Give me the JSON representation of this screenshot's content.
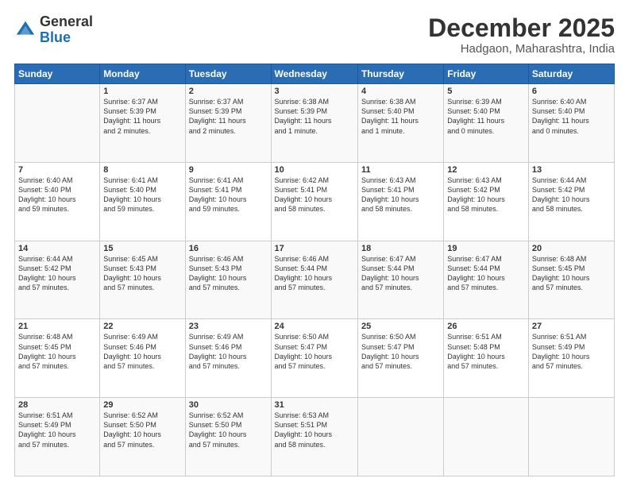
{
  "logo": {
    "general": "General",
    "blue": "Blue"
  },
  "header": {
    "month": "December 2025",
    "location": "Hadgaon, Maharashtra, India"
  },
  "days_of_week": [
    "Sunday",
    "Monday",
    "Tuesday",
    "Wednesday",
    "Thursday",
    "Friday",
    "Saturday"
  ],
  "weeks": [
    [
      {
        "day": "",
        "info": ""
      },
      {
        "day": "1",
        "info": "Sunrise: 6:37 AM\nSunset: 5:39 PM\nDaylight: 11 hours\nand 2 minutes."
      },
      {
        "day": "2",
        "info": "Sunrise: 6:37 AM\nSunset: 5:39 PM\nDaylight: 11 hours\nand 2 minutes."
      },
      {
        "day": "3",
        "info": "Sunrise: 6:38 AM\nSunset: 5:39 PM\nDaylight: 11 hours\nand 1 minute."
      },
      {
        "day": "4",
        "info": "Sunrise: 6:38 AM\nSunset: 5:40 PM\nDaylight: 11 hours\nand 1 minute."
      },
      {
        "day": "5",
        "info": "Sunrise: 6:39 AM\nSunset: 5:40 PM\nDaylight: 11 hours\nand 0 minutes."
      },
      {
        "day": "6",
        "info": "Sunrise: 6:40 AM\nSunset: 5:40 PM\nDaylight: 11 hours\nand 0 minutes."
      }
    ],
    [
      {
        "day": "7",
        "info": "Sunrise: 6:40 AM\nSunset: 5:40 PM\nDaylight: 10 hours\nand 59 minutes."
      },
      {
        "day": "8",
        "info": "Sunrise: 6:41 AM\nSunset: 5:40 PM\nDaylight: 10 hours\nand 59 minutes."
      },
      {
        "day": "9",
        "info": "Sunrise: 6:41 AM\nSunset: 5:41 PM\nDaylight: 10 hours\nand 59 minutes."
      },
      {
        "day": "10",
        "info": "Sunrise: 6:42 AM\nSunset: 5:41 PM\nDaylight: 10 hours\nand 58 minutes."
      },
      {
        "day": "11",
        "info": "Sunrise: 6:43 AM\nSunset: 5:41 PM\nDaylight: 10 hours\nand 58 minutes."
      },
      {
        "day": "12",
        "info": "Sunrise: 6:43 AM\nSunset: 5:42 PM\nDaylight: 10 hours\nand 58 minutes."
      },
      {
        "day": "13",
        "info": "Sunrise: 6:44 AM\nSunset: 5:42 PM\nDaylight: 10 hours\nand 58 minutes."
      }
    ],
    [
      {
        "day": "14",
        "info": "Sunrise: 6:44 AM\nSunset: 5:42 PM\nDaylight: 10 hours\nand 57 minutes."
      },
      {
        "day": "15",
        "info": "Sunrise: 6:45 AM\nSunset: 5:43 PM\nDaylight: 10 hours\nand 57 minutes."
      },
      {
        "day": "16",
        "info": "Sunrise: 6:46 AM\nSunset: 5:43 PM\nDaylight: 10 hours\nand 57 minutes."
      },
      {
        "day": "17",
        "info": "Sunrise: 6:46 AM\nSunset: 5:44 PM\nDaylight: 10 hours\nand 57 minutes."
      },
      {
        "day": "18",
        "info": "Sunrise: 6:47 AM\nSunset: 5:44 PM\nDaylight: 10 hours\nand 57 minutes."
      },
      {
        "day": "19",
        "info": "Sunrise: 6:47 AM\nSunset: 5:44 PM\nDaylight: 10 hours\nand 57 minutes."
      },
      {
        "day": "20",
        "info": "Sunrise: 6:48 AM\nSunset: 5:45 PM\nDaylight: 10 hours\nand 57 minutes."
      }
    ],
    [
      {
        "day": "21",
        "info": "Sunrise: 6:48 AM\nSunset: 5:45 PM\nDaylight: 10 hours\nand 57 minutes."
      },
      {
        "day": "22",
        "info": "Sunrise: 6:49 AM\nSunset: 5:46 PM\nDaylight: 10 hours\nand 57 minutes."
      },
      {
        "day": "23",
        "info": "Sunrise: 6:49 AM\nSunset: 5:46 PM\nDaylight: 10 hours\nand 57 minutes."
      },
      {
        "day": "24",
        "info": "Sunrise: 6:50 AM\nSunset: 5:47 PM\nDaylight: 10 hours\nand 57 minutes."
      },
      {
        "day": "25",
        "info": "Sunrise: 6:50 AM\nSunset: 5:47 PM\nDaylight: 10 hours\nand 57 minutes."
      },
      {
        "day": "26",
        "info": "Sunrise: 6:51 AM\nSunset: 5:48 PM\nDaylight: 10 hours\nand 57 minutes."
      },
      {
        "day": "27",
        "info": "Sunrise: 6:51 AM\nSunset: 5:49 PM\nDaylight: 10 hours\nand 57 minutes."
      }
    ],
    [
      {
        "day": "28",
        "info": "Sunrise: 6:51 AM\nSunset: 5:49 PM\nDaylight: 10 hours\nand 57 minutes."
      },
      {
        "day": "29",
        "info": "Sunrise: 6:52 AM\nSunset: 5:50 PM\nDaylight: 10 hours\nand 57 minutes."
      },
      {
        "day": "30",
        "info": "Sunrise: 6:52 AM\nSunset: 5:50 PM\nDaylight: 10 hours\nand 57 minutes."
      },
      {
        "day": "31",
        "info": "Sunrise: 6:53 AM\nSunset: 5:51 PM\nDaylight: 10 hours\nand 58 minutes."
      },
      {
        "day": "",
        "info": ""
      },
      {
        "day": "",
        "info": ""
      },
      {
        "day": "",
        "info": ""
      }
    ]
  ]
}
